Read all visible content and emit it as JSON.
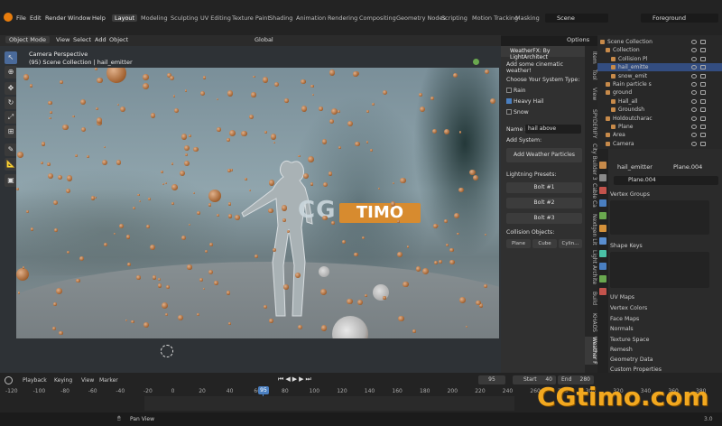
{
  "menus": [
    "File",
    "Edit",
    "Render",
    "Window",
    "Help"
  ],
  "workspace_tabs": [
    "Layout",
    "Modeling",
    "Sculpting",
    "UV Editing",
    "Texture Paint",
    "Shading",
    "Animation",
    "Rendering",
    "Compositing",
    "Geometry Nodes",
    "Scripting",
    "Motion Tracking",
    "Masking"
  ],
  "scene": "Scene",
  "view_layer": "Foreground",
  "header": {
    "mode": "Object Mode",
    "menu": [
      "View",
      "Select",
      "Add",
      "Object"
    ],
    "transform": "Global",
    "options": "Options"
  },
  "viewport": {
    "camera_label": "Camera Perspective",
    "collection_label": "(95) Scene Collection | hail_emitter"
  },
  "npanel": {
    "title": "WeatherFX: By LightArchitect",
    "intro": "Add some cinematic weather!",
    "choose_label": "Choose Your System Type:",
    "types": [
      {
        "label": "Rain",
        "checked": false
      },
      {
        "label": "Heavy Hail",
        "checked": true
      },
      {
        "label": "Snow",
        "checked": false
      }
    ],
    "name_label": "Name it:",
    "name_value": "hail above",
    "add_system_label": "Add System:",
    "add_button": "Add Weather Particles",
    "lightning_label": "Lightning Presets:",
    "bolts": [
      "Bolt #1",
      "Bolt #2",
      "Bolt #3"
    ],
    "collision_label": "Collision Objects:",
    "collision_buttons": [
      "Plane",
      "Cube",
      "Cylin..."
    ]
  },
  "ntabs": [
    "Item",
    "Tool",
    "View",
    "SPYDERIFY",
    "City Builder 3",
    "Cable Ca",
    "Nextgen Lit",
    "Light Archite",
    "Build",
    "KHAOS",
    "Weather F"
  ],
  "outliner": {
    "rows": [
      {
        "label": "Scene Collection",
        "selected": false
      },
      {
        "label": "Collection",
        "selected": false
      },
      {
        "label": "Collision Pl",
        "selected": false
      },
      {
        "label": "hail_emitte",
        "selected": true
      },
      {
        "label": "snow_emit",
        "selected": false
      },
      {
        "label": "Rain particle s",
        "selected": false
      },
      {
        "label": "ground",
        "selected": false
      },
      {
        "label": "Hall_all",
        "selected": false
      },
      {
        "label": "Groundsh",
        "selected": false
      },
      {
        "label": "Holdoutcharac",
        "selected": false
      },
      {
        "label": "Plane",
        "selected": false
      },
      {
        "label": "Area",
        "selected": false
      },
      {
        "label": "Camera",
        "selected": false
      }
    ]
  },
  "properties": {
    "object": "hail_emitter",
    "mesh": "Plane.004",
    "data_name": "Plane.004",
    "sections": [
      "Vertex Groups",
      "Shape Keys",
      "UV Maps",
      "Vertex Colors",
      "Face Maps",
      "Normals",
      "Texture Space",
      "Remesh",
      "Geometry Data",
      "Custom Properties"
    ]
  },
  "timeline": {
    "menu": [
      "Playback",
      "Keying",
      "View",
      "Marker"
    ],
    "current_frame": "95",
    "start_label": "Start",
    "start": "40",
    "end_label": "End",
    "end": "280",
    "ticks": [
      "-120",
      "-100",
      "-80",
      "-60",
      "-40",
      "-20",
      "0",
      "20",
      "40",
      "60",
      "80",
      "100",
      "120",
      "140",
      "160",
      "180",
      "200",
      "220",
      "240",
      "260",
      "280",
      "300",
      "320",
      "340",
      "360",
      "380"
    ],
    "status": "Pan View",
    "version": "3.0"
  },
  "watermarks": {
    "center_left": "CG",
    "center_right": "TIMO",
    "bottom": "CGtimo.com"
  },
  "colors": {
    "accent": "#4a7fc1",
    "selected_row": "#334d80",
    "particle": "#c07a48"
  }
}
